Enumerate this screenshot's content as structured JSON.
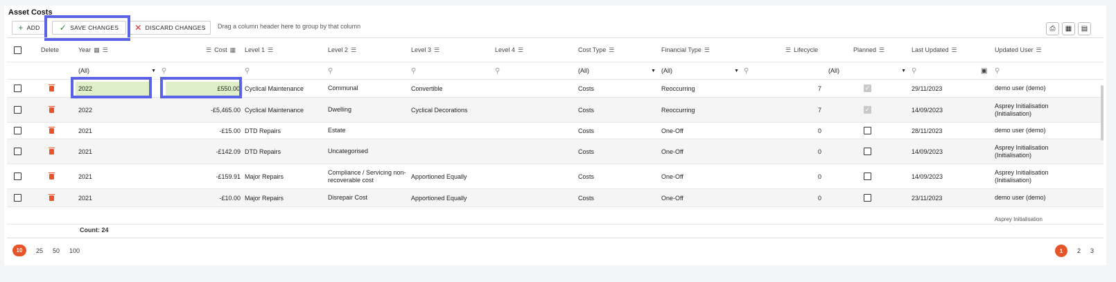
{
  "title": "Asset Costs",
  "toolbar": {
    "add_label": "ADD",
    "save_label": "SAVE CHANGES",
    "discard_label": "DISCARD CHANGES",
    "drag_hint": "Drag a column header here to group by that column"
  },
  "columns": {
    "delete": "Delete",
    "year": "Year",
    "cost": "Cost",
    "level1": "Level 1",
    "level2": "Level 2",
    "level3": "Level 3",
    "level4": "Level 4",
    "cost_type": "Cost Type",
    "financial_type": "Financial Type",
    "lifecycle": "Lifecycle",
    "planned": "Planned",
    "last_updated": "Last Updated",
    "updated_user": "Updated User"
  },
  "filters": {
    "year": "(All)",
    "cost_type": "(All)",
    "financial_type": "(All)",
    "planned": "(All)"
  },
  "rows": [
    {
      "year": "2022",
      "cost": "£550.00",
      "level1": "Cyclical Maintenance",
      "level2": "Communal",
      "level3": "Convertible",
      "cost_type": "Costs",
      "financial_type": "Reoccurring",
      "lifecycle": "7",
      "planned": true,
      "last_updated": "29/11/2023",
      "user": "demo user (demo)"
    },
    {
      "year": "2022",
      "cost": "-£5,465.00",
      "level1": "Cyclical Maintenance",
      "level2": "Dwelling",
      "level3": "Cyclical Decorations",
      "cost_type": "Costs",
      "financial_type": "Reoccurring",
      "lifecycle": "7",
      "planned": true,
      "last_updated": "14/09/2023",
      "user": "Asprey Initialisation (Initialisation)"
    },
    {
      "year": "2021",
      "cost": "-£15.00",
      "level1": "DTD Repairs",
      "level2": "Estate",
      "level3": "",
      "cost_type": "Costs",
      "financial_type": "One-Off",
      "lifecycle": "0",
      "planned": false,
      "last_updated": "28/11/2023",
      "user": "demo user (demo)"
    },
    {
      "year": "2021",
      "cost": "-£142.09",
      "level1": "DTD Repairs",
      "level2": "Uncategorised",
      "level3": "",
      "cost_type": "Costs",
      "financial_type": "One-Off",
      "lifecycle": "0",
      "planned": false,
      "last_updated": "14/09/2023",
      "user": "Asprey Initialisation (Initialisation)"
    },
    {
      "year": "2021",
      "cost": "-£159.91",
      "level1": "Major Repairs",
      "level2": "Compliance / Servicing non-recoverable cost",
      "level3": "Apportioned Equally",
      "cost_type": "Costs",
      "financial_type": "One-Off",
      "lifecycle": "0",
      "planned": false,
      "last_updated": "14/09/2023",
      "user": "Asprey Initialisation (Initialisation)"
    },
    {
      "year": "2021",
      "cost": "-£10.00",
      "level1": "Major Repairs",
      "level2": "Disrepair Cost",
      "level3": "Apportioned Equally",
      "cost_type": "Costs",
      "financial_type": "One-Off",
      "lifecycle": "0",
      "planned": false,
      "last_updated": "23/11/2023",
      "user": "demo user (demo)"
    }
  ],
  "partial_row_user": "Asprey Initialisation",
  "footer": {
    "count": "Count: 24"
  },
  "page_sizes": [
    "10",
    "25",
    "50",
    "100"
  ],
  "pages": [
    "1",
    "2",
    "3"
  ],
  "colors": {
    "accent": "#e8542a",
    "highlight": "#5a63e8",
    "edited": "#dff0c8"
  }
}
